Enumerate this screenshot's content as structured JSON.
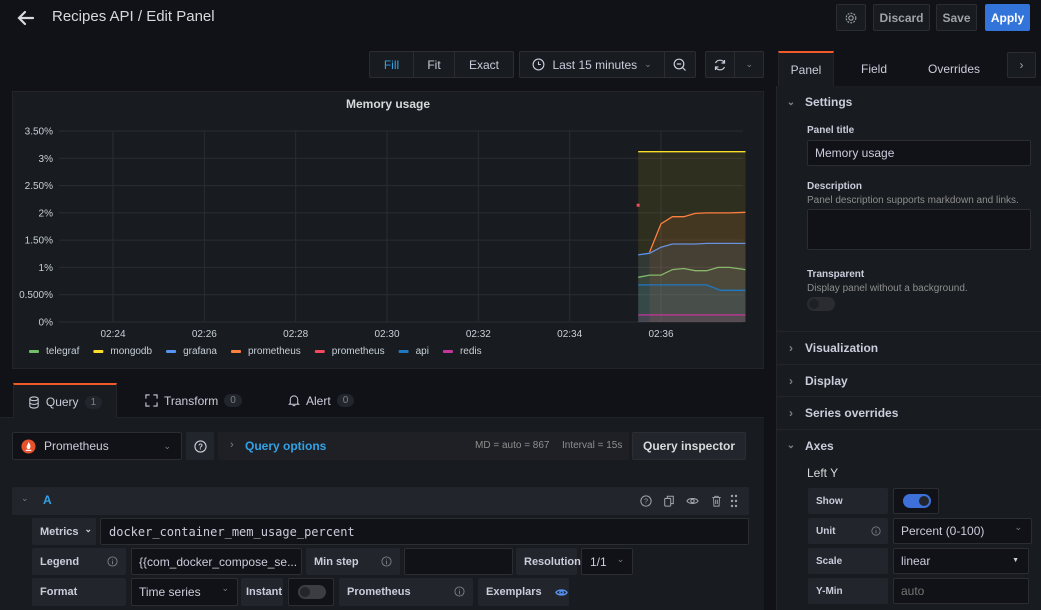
{
  "header": {
    "title": "Recipes API / Edit Panel",
    "discard_label": "Discard",
    "save_label": "Save",
    "apply_label": "Apply"
  },
  "toolbar": {
    "view_modes": [
      "Fill",
      "Fit",
      "Exact"
    ],
    "active_view_mode": "Fill",
    "time_range": "Last 15 minutes"
  },
  "chart_data": {
    "type": "line",
    "title": "Memory usage",
    "xlabel": "",
    "ylabel": "",
    "ylim": [
      0,
      3.5
    ],
    "y_ticks": [
      "0%",
      "0.500%",
      "1%",
      "1.50%",
      "2%",
      "2.50%",
      "3%",
      "3.50%"
    ],
    "y_tick_values": [
      0,
      0.5,
      1,
      1.5,
      2,
      2.5,
      3,
      3.5
    ],
    "x_ticks": [
      "02:24",
      "02:26",
      "02:28",
      "02:30",
      "02:32",
      "02:34",
      "02:36"
    ],
    "x_tick_minutes": [
      144,
      146,
      148,
      150,
      152,
      154,
      156
    ],
    "xlim_minutes": [
      143.0,
      157.9
    ],
    "grid": true,
    "fill": true,
    "legend_position": "bottom-left",
    "series": [
      {
        "name": "telegraf",
        "color": "#73bf69",
        "x": [
          155.5,
          155.75,
          156.0,
          156.25,
          156.5,
          156.75,
          157.0,
          157.25,
          157.5,
          157.85
        ],
        "values": [
          0.82,
          0.86,
          0.86,
          0.96,
          0.98,
          0.94,
          0.94,
          1.0,
          1.0,
          0.96
        ]
      },
      {
        "name": "mongodb",
        "color": "#fade2a",
        "x": [
          155.5,
          157.85
        ],
        "values": [
          3.12,
          3.12
        ]
      },
      {
        "name": "grafana",
        "color": "#5794f2",
        "x": [
          155.5,
          155.75,
          156.0,
          156.25,
          156.5,
          156.75,
          157.0,
          157.25,
          157.5,
          157.85
        ],
        "values": [
          1.23,
          1.26,
          1.37,
          1.43,
          1.43,
          1.43,
          1.44,
          1.44,
          1.44,
          1.44
        ]
      },
      {
        "name": "prometheus",
        "color": "#ff7f3f",
        "x": [
          155.75,
          156.0,
          156.25,
          156.5,
          156.75,
          157.0,
          157.5,
          157.85
        ],
        "values": [
          1.28,
          1.8,
          1.93,
          1.93,
          1.99,
          2.0,
          2.0,
          2.01
        ]
      },
      {
        "name": "prometheus",
        "color": "#f2495c",
        "x": [
          155.5
        ],
        "values": [
          2.14
        ]
      },
      {
        "name": "api",
        "color": "#1f78c1",
        "x": [
          155.5,
          157.0,
          157.3,
          157.85
        ],
        "values": [
          0.68,
          0.68,
          0.58,
          0.58
        ]
      },
      {
        "name": "redis",
        "color": "#c4369b",
        "x": [
          155.5,
          157.85
        ],
        "values": [
          0.13,
          0.13
        ]
      }
    ]
  },
  "query_tabs": [
    {
      "label": "Query",
      "count": "1"
    },
    {
      "label": "Transform",
      "count": "0"
    },
    {
      "label": "Alert",
      "count": "0"
    }
  ],
  "query": {
    "datasource": "Prometheus",
    "options_label": "Query options",
    "md_info": "MD = auto = 867",
    "interval_info": "Interval = 15s",
    "inspector_label": "Query inspector",
    "ref_id": "A",
    "metrics_label": "Metrics",
    "metrics_value": "docker_container_mem_usage_percent",
    "legend_label": "Legend",
    "legend_value": "{{com_docker_compose_se...",
    "min_step_label": "Min step",
    "min_step_value": "",
    "resolution_label": "Resolution",
    "resolution_value": "1/1",
    "format_label": "Format",
    "format_value": "Time series",
    "instant_label": "Instant",
    "instant_on": false,
    "prometheus_label": "Prometheus",
    "exemplars_label": "Exemplars"
  },
  "sidebar": {
    "tabs": [
      "Panel",
      "Field",
      "Overrides"
    ],
    "active_tab": "Panel",
    "settings": {
      "header": "Settings",
      "panel_title_label": "Panel title",
      "panel_title_value": "Memory usage",
      "description_label": "Description",
      "description_hint": "Panel description supports markdown and links.",
      "description_value": "",
      "transparent_label": "Transparent",
      "transparent_hint": "Display panel without a background.",
      "transparent_on": false
    },
    "sections": [
      "Visualization",
      "Display",
      "Series overrides"
    ],
    "axes": {
      "header": "Axes",
      "left_y": "Left Y",
      "show_label": "Show",
      "show_on": true,
      "unit_label": "Unit",
      "unit_value": "Percent (0-100)",
      "scale_label": "Scale",
      "scale_value": "linear",
      "ymin_label": "Y-Min",
      "ymin_placeholder": "auto"
    }
  }
}
